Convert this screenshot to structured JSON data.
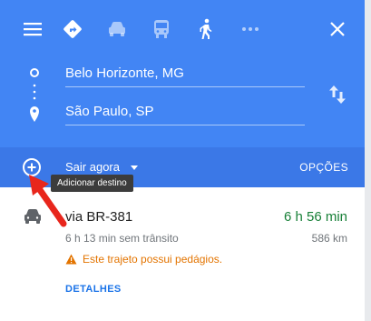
{
  "header": {
    "menu_icon": "menu-icon",
    "close_icon": "close-icon",
    "travel_modes": [
      {
        "name": "best-route",
        "icon": "diamond-turn-icon",
        "selected": true
      },
      {
        "name": "driving",
        "icon": "car-icon",
        "selected": false
      },
      {
        "name": "transit",
        "icon": "bus-icon",
        "selected": false
      },
      {
        "name": "walking",
        "icon": "walk-icon",
        "selected": false
      },
      {
        "name": "more",
        "icon": "more-horiz-icon",
        "selected": false
      }
    ]
  },
  "route": {
    "origin": "Belo Horizonte, MG",
    "destination": "São Paulo, SP",
    "swap_icon": "swap-vertical-icon"
  },
  "bar": {
    "depart_label": "Sair agora",
    "options_label": "OPÇÕES",
    "add_destination_icon": "add-circle-icon",
    "tooltip": "Adicionar destino"
  },
  "result": {
    "route_name": "via BR-381",
    "duration": "6 h 56 min",
    "no_traffic": "6 h 13 min sem trânsito",
    "distance": "586 km",
    "warning": "Este trajeto possui pedágios.",
    "details_label": "DETALHES"
  },
  "colors": {
    "header_blue": "#4285f4",
    "bar_blue": "#3b78e7",
    "duration_green": "#188038",
    "warning_orange": "#e37400",
    "link_blue": "#1a73e8",
    "annotation_red": "#e8261c"
  }
}
